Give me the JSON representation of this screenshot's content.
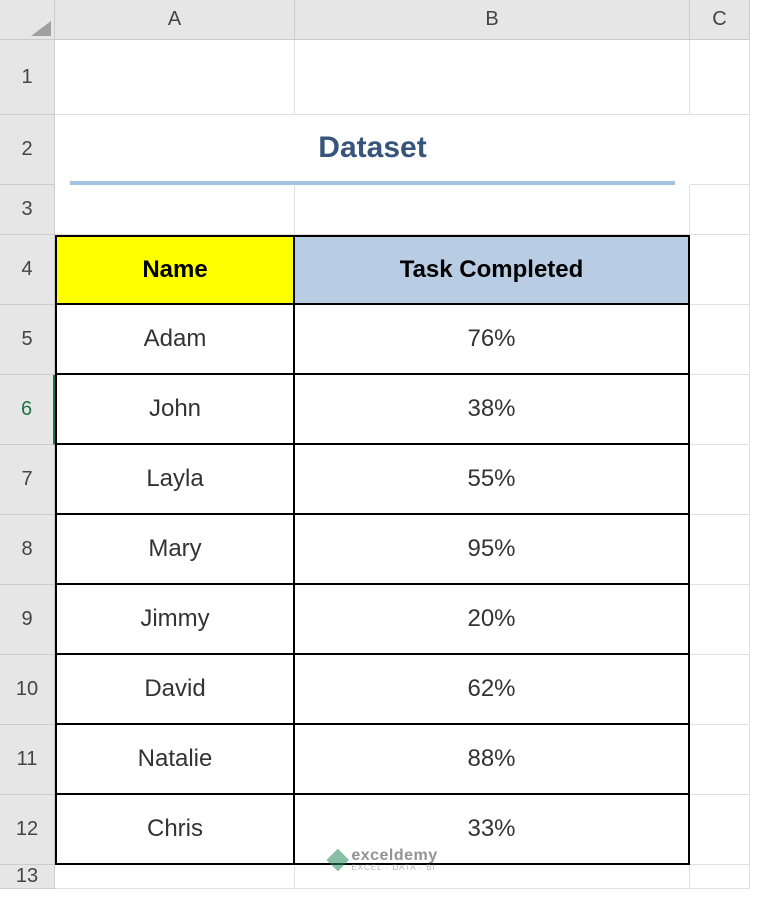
{
  "columns": [
    "A",
    "B",
    "C"
  ],
  "rows": [
    "1",
    "2",
    "3",
    "4",
    "5",
    "6",
    "7",
    "8",
    "9",
    "10",
    "11",
    "12",
    "13"
  ],
  "activeRow": "6",
  "title": "Dataset",
  "headers": {
    "name": "Name",
    "task": "Task Completed"
  },
  "data": [
    {
      "name": "Adam",
      "task": "76%"
    },
    {
      "name": "John",
      "task": "38%"
    },
    {
      "name": "Layla",
      "task": "55%"
    },
    {
      "name": "Mary",
      "task": "95%"
    },
    {
      "name": "Jimmy",
      "task": "20%"
    },
    {
      "name": "David",
      "task": "62%"
    },
    {
      "name": "Natalie",
      "task": "88%"
    },
    {
      "name": "Chris",
      "task": "33%"
    }
  ],
  "watermark": {
    "brand": "exceldemy",
    "tagline": "EXCEL · DATA · BI"
  },
  "chart_data": {
    "type": "table",
    "columns": [
      "Name",
      "Task Completed"
    ],
    "rows": [
      [
        "Adam",
        "76%"
      ],
      [
        "John",
        "38%"
      ],
      [
        "Layla",
        "55%"
      ],
      [
        "Mary",
        "95%"
      ],
      [
        "Jimmy",
        "20%"
      ],
      [
        "David",
        "62%"
      ],
      [
        "Natalie",
        "88%"
      ],
      [
        "Chris",
        "33%"
      ]
    ]
  }
}
